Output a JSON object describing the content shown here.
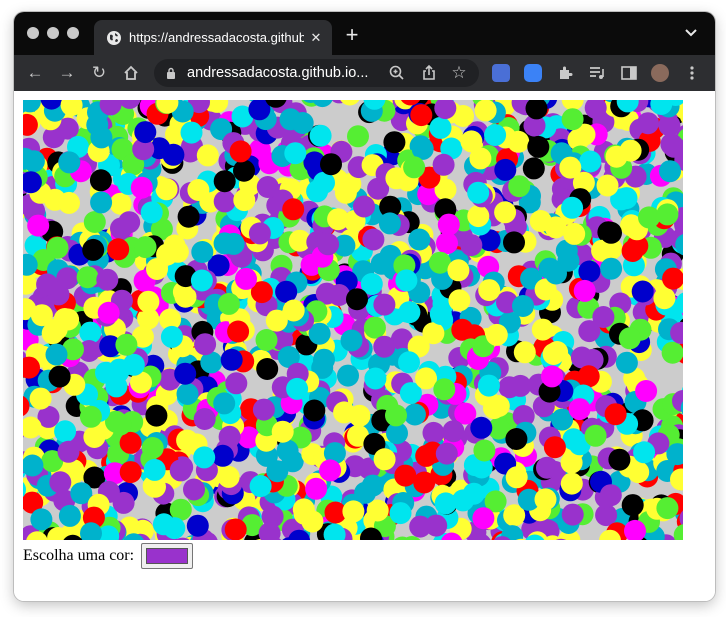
{
  "browser": {
    "tab_title": "https://andressadacosta.github.io",
    "tab_close_glyph": "✕",
    "new_tab_glyph": "+",
    "url": "andressadacosta.github.io...",
    "nav_icons": [
      "back-arrow-icon",
      "forward-arrow-icon",
      "reload-icon",
      "home-icon"
    ],
    "omnibox_icons": [
      "zoom-icon",
      "share-icon",
      "bookmark-star-icon"
    ],
    "extension_icons": [
      "translate-icon",
      "zoom-meeting-icon",
      "puzzle-extensions-icon",
      "media-playlist-icon",
      "side-panel-icon",
      "profile-avatar-icon",
      "kebab-menu-icon"
    ]
  },
  "page": {
    "color_label": "Escolha uma cor:",
    "selected_color": "#9932cc"
  },
  "canvas_art": {
    "background": "#cccccc",
    "palette": [
      "#ff0000",
      "#0000cc",
      "#000000",
      "#ff00ff",
      "#00e5ee",
      "#55ee33",
      "#ffff33",
      "#00b2cc",
      "#9932cc"
    ]
  }
}
